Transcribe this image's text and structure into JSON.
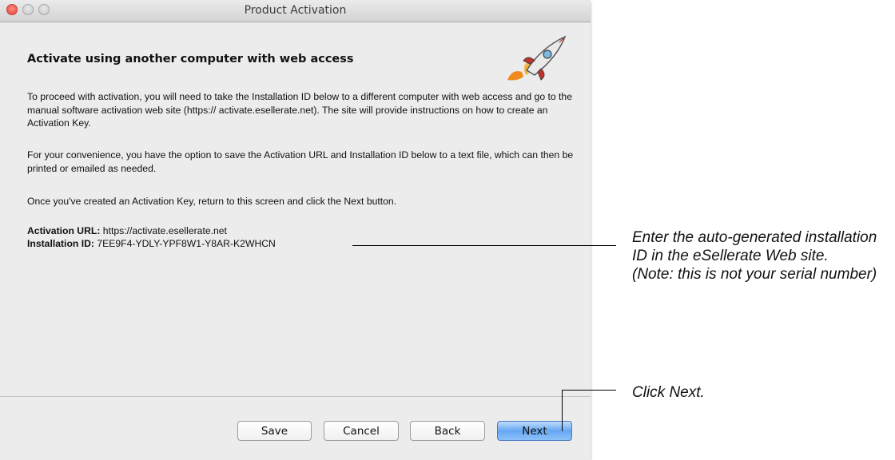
{
  "window": {
    "title": "Product Activation",
    "heading": "Activate using another computer with web access",
    "paragraphs": [
      "To proceed with activation, you will need to take the Installation ID below to a different computer with web access and go to the manual software activation web site (https:// activate.esellerate.net). The site will provide instructions on how to create an Activation Key.",
      "For your convenience, you have the option to save the Activation URL and Installation ID below to a text file, which can then be printed or emailed as needed.",
      "Once you've created an Activation Key, return to this screen and click the Next button."
    ],
    "activation_url_label": "Activation URL:",
    "activation_url_value": "https://activate.esellerate.net",
    "installation_id_label": "Installation ID:",
    "installation_id_value": "7EE9F4-YDLY-YPF8W1-Y8AR-K2WHCN",
    "buttons": {
      "save": "Save",
      "cancel": "Cancel",
      "back": "Back",
      "next": "Next"
    },
    "icons": {
      "logo": "rocket-icon"
    },
    "colors": {
      "default_button": "#66a7f3",
      "close_button": "#e0443e"
    }
  },
  "annotations": {
    "installation_id_note_1": "Enter the auto-generated installation ID in the eSellerate Web site.",
    "installation_id_note_2": "(Note: this is not your serial number)",
    "next_note": "Click Next."
  }
}
